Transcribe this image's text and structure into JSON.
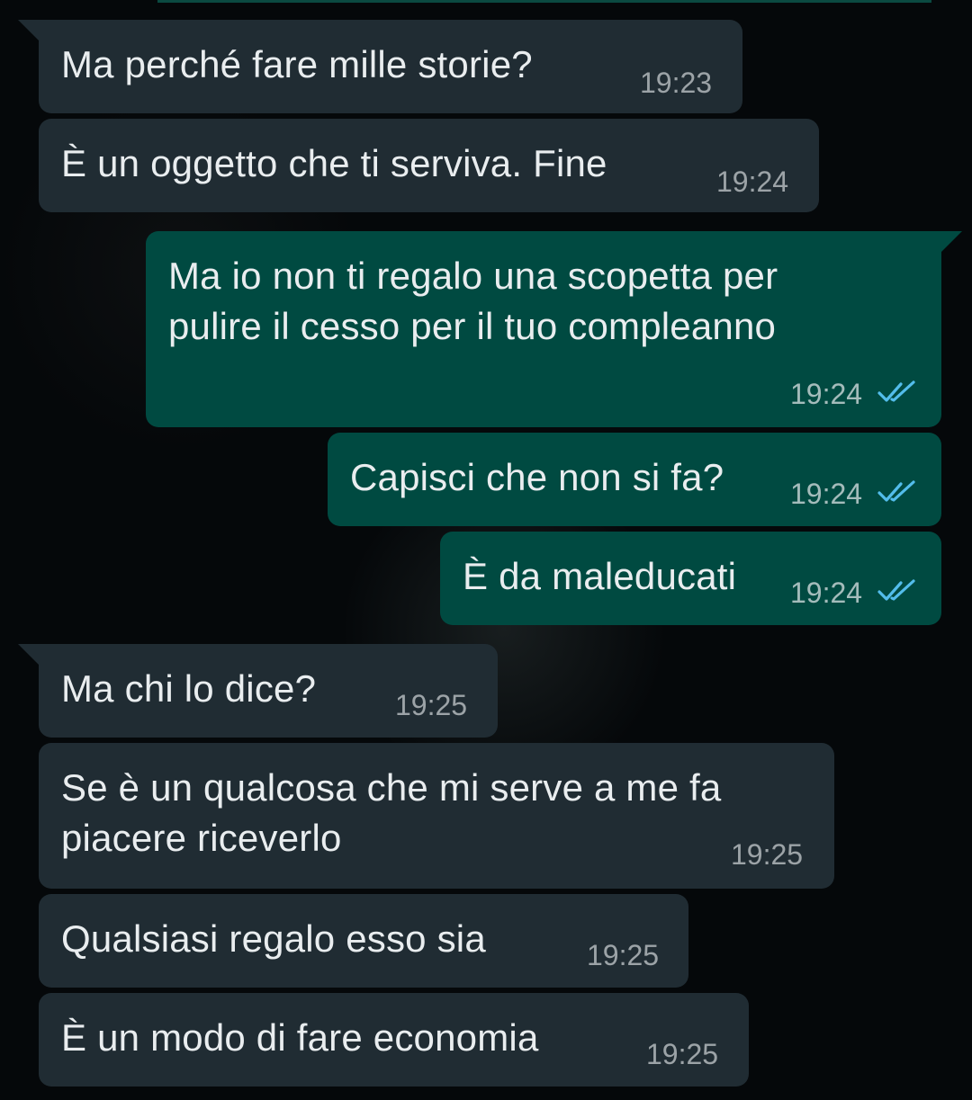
{
  "theme": {
    "incoming_bubble": "#202c33",
    "outgoing_bubble": "#004a41",
    "read_tick_color": "#53bdeb"
  },
  "messages": [
    {
      "direction": "in",
      "text": "Ma perché fare mille storie?",
      "time": "19:23"
    },
    {
      "direction": "in",
      "text": "È un oggetto che ti serviva. Fine",
      "time": "19:24"
    },
    {
      "direction": "out",
      "text": "Ma io non ti regalo una scopetta per\npulire il cesso per il tuo compleanno",
      "time": "19:24",
      "status_icon": "double-check-read-icon"
    },
    {
      "direction": "out",
      "text": "Capisci che non si fa?",
      "time": "19:24",
      "status_icon": "double-check-read-icon"
    },
    {
      "direction": "out",
      "text": "È da maleducati",
      "time": "19:24",
      "status_icon": "double-check-read-icon"
    },
    {
      "direction": "in",
      "text": "Ma chi lo dice?",
      "time": "19:25"
    },
    {
      "direction": "in",
      "text": "Se è un qualcosa che mi serve a me fa\npiacere riceverlo",
      "time": "19:25"
    },
    {
      "direction": "in",
      "text": "Qualsiasi regalo esso sia",
      "time": "19:25"
    },
    {
      "direction": "in",
      "text": "È un modo di fare economia",
      "time": "19:25"
    }
  ]
}
